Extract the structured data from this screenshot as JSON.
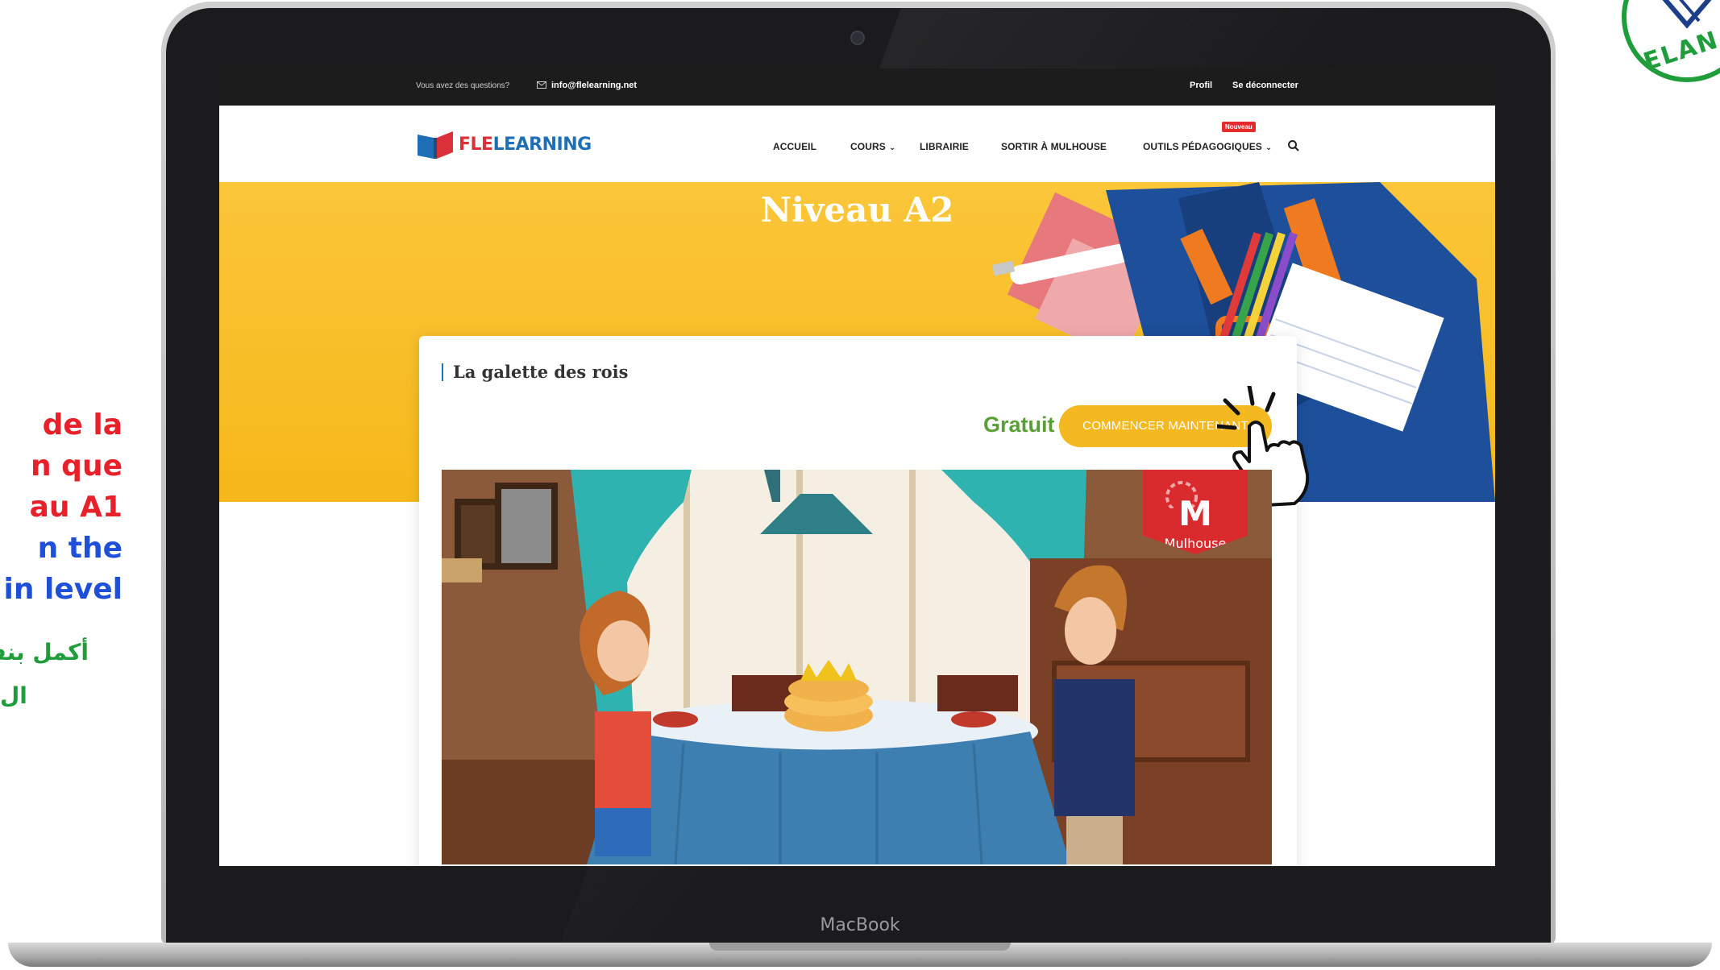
{
  "side_promo": {
    "lines_red": [
      "de la",
      "n que",
      "au A1"
    ],
    "lines_blue": [
      "n the",
      "in level"
    ],
    "lines_green": [
      "أكمل بنفس",
      "ال"
    ]
  },
  "badge": {
    "text": "ELAN"
  },
  "laptop": {
    "brand": "MacBook"
  },
  "topbar": {
    "question": "Vous avez des questions?",
    "email": "info@flelearning.net",
    "profile_label": "Profil",
    "logout_label": "Se déconnecter"
  },
  "navbar": {
    "logo_part1": "FLE",
    "logo_part2": "LEARNING",
    "items": [
      {
        "label": "ACCUEIL"
      },
      {
        "label": "COURS"
      },
      {
        "label": "LIBRAIRIE"
      },
      {
        "label": "SORTIR À MULHOUSE"
      },
      {
        "label": "OUTILS PÉDAGOGIQUES"
      }
    ],
    "new_badge": "Nouveau"
  },
  "hero": {
    "title": "Niveau A2"
  },
  "course": {
    "title": "La galette des rois",
    "price": "Gratuit",
    "cta": "COMMENCER MAINTENANT",
    "image_badge": {
      "letter": "M",
      "city": "Mulhouse"
    }
  },
  "colors": {
    "hero_yellow": "#f6b81a",
    "cta_yellow": "#f4b821",
    "price_green": "#58a036",
    "logo_red": "#d9303a",
    "logo_blue": "#1e6fb5",
    "badge_red": "#d92a2e"
  },
  "icons": [
    "mail-icon",
    "chevron-down-icon",
    "search-icon",
    "hand-cursor-icon",
    "backpack-illustration",
    "gear-icon"
  ]
}
